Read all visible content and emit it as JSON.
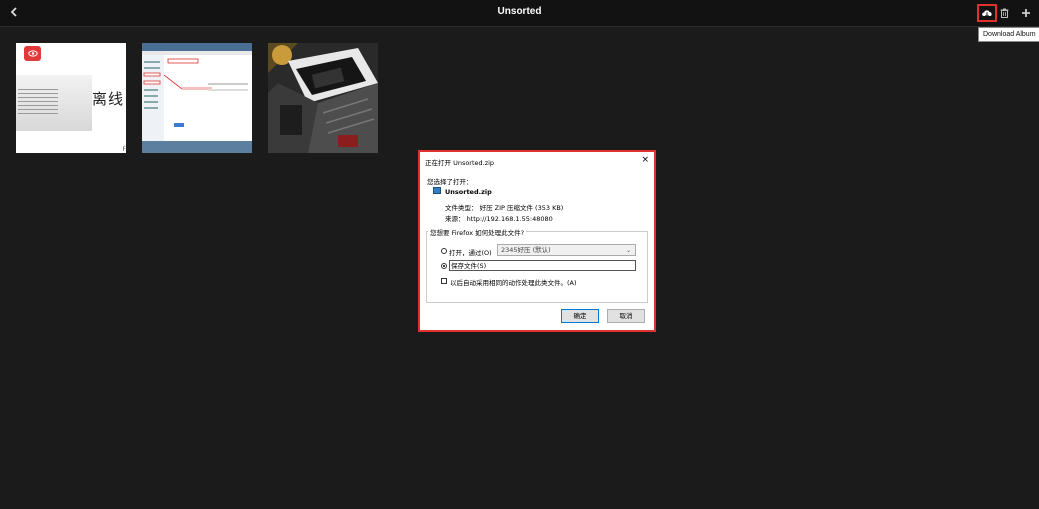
{
  "header": {
    "title": "Unsorted",
    "tooltip": "Download Album"
  },
  "thumbnails": [
    {
      "text": "离线",
      "corner": "F"
    },
    {
      "text": ""
    },
    {
      "text": ""
    }
  ],
  "dialog": {
    "title": "正在打开 Unsorted.zip",
    "close": "×",
    "chosen_label": "您选择了打开：",
    "filename": "Unsorted.zip",
    "file_type": "文件类型：  好压 ZIP 压缩文件 (353 KB)",
    "source": "来源：  http://192.168.1.55:48080",
    "question": "您想要 Firefox 如何处理此文件?",
    "open_label": "打开，通过(O)",
    "open_app": "2345好压 (默认)",
    "save_label": "保存文件(S)",
    "auto_label": "以后自动采用相同的动作处理此类文件。(A)",
    "ok_label": "确定",
    "cancel_label": "取消"
  },
  "colors": {
    "highlight": "#e03030",
    "background": "#1b1b1b",
    "badge": "#e23a3a"
  }
}
